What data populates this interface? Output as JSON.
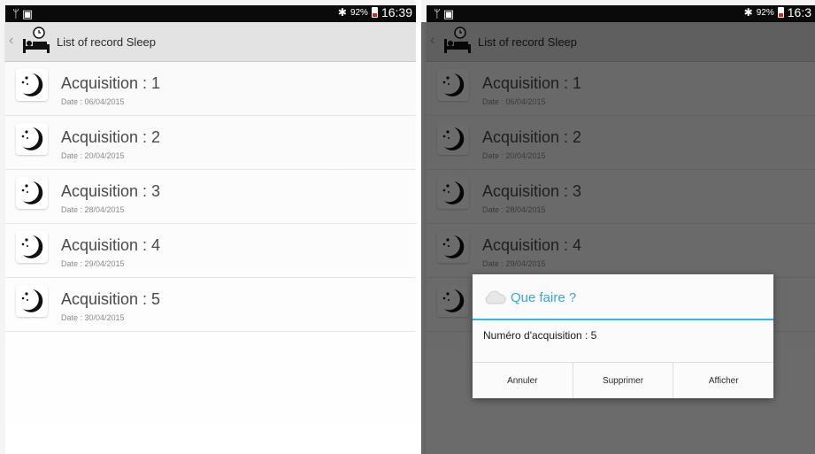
{
  "status_bar": {
    "left_icons": [
      "usb-icon",
      "image-icon"
    ],
    "battery_percent": "92%",
    "time_left": "16:39",
    "time_right": "16:3"
  },
  "action_bar": {
    "title": "List of record Sleep",
    "icons": [
      "back-chevron-icon",
      "bed-alarm-icon"
    ]
  },
  "records": [
    {
      "title": "Acquisition : 1",
      "date": "Date : 06/04/2015"
    },
    {
      "title": "Acquisition : 2",
      "date": "Date : 20/04/2015"
    },
    {
      "title": "Acquisition : 3",
      "date": "Date : 28/04/2015"
    },
    {
      "title": "Acquisition : 4",
      "date": "Date : 29/04/2015"
    },
    {
      "title": "Acquisition : 5",
      "date": "Date : 30/04/2015"
    }
  ],
  "dialog": {
    "title": "Que faire ?",
    "message": "Numéro d'acquisition : 5",
    "buttons": {
      "cancel": "Annuler",
      "delete": "Supprimer",
      "show": "Afficher"
    }
  },
  "colors": {
    "status_bar": "#0a0a0a",
    "action_bar": "#e3e3e3",
    "dialog_accent": "#33b5e5",
    "battery_low": "#d32222"
  }
}
